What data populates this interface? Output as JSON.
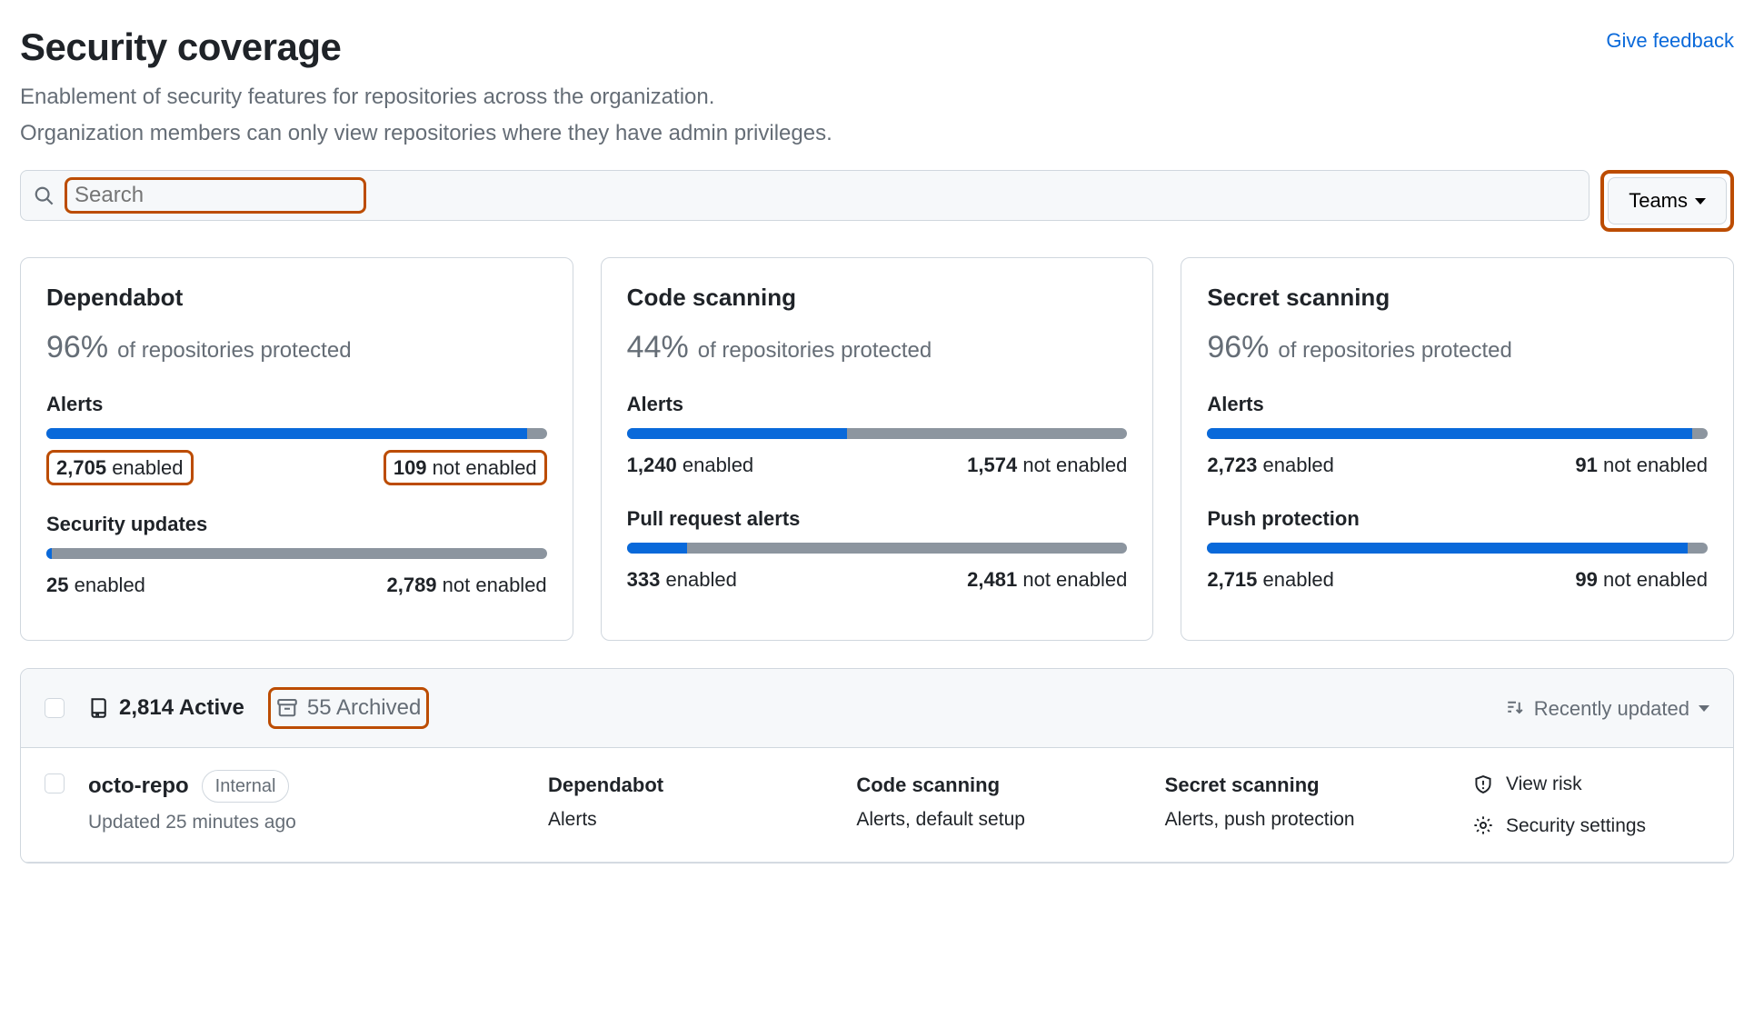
{
  "header": {
    "title": "Security coverage",
    "subtitle1": "Enablement of security features for repositories across the organization.",
    "subtitle2": "Organization members can only view repositories where they have admin privileges.",
    "feedback_label": "Give feedback"
  },
  "search": {
    "placeholder": "Search",
    "teams_label": "Teams"
  },
  "cards": [
    {
      "title": "Dependabot",
      "pct": "96%",
      "pct_suffix": "of repositories protected",
      "metrics": [
        {
          "label": "Alerts",
          "enabled_n": "2,705",
          "notenabled_n": "109",
          "fill": 96,
          "highlight_counts": true
        },
        {
          "label": "Security updates",
          "enabled_n": "25",
          "notenabled_n": "2,789",
          "fill": 1
        }
      ]
    },
    {
      "title": "Code scanning",
      "pct": "44%",
      "pct_suffix": "of repositories protected",
      "metrics": [
        {
          "label": "Alerts",
          "enabled_n": "1,240",
          "notenabled_n": "1,574",
          "fill": 44
        },
        {
          "label": "Pull request alerts",
          "enabled_n": "333",
          "notenabled_n": "2,481",
          "fill": 12
        }
      ]
    },
    {
      "title": "Secret scanning",
      "pct": "96%",
      "pct_suffix": "of repositories protected",
      "metrics": [
        {
          "label": "Alerts",
          "enabled_n": "2,723",
          "notenabled_n": "91",
          "fill": 97
        },
        {
          "label": "Push protection",
          "enabled_n": "2,715",
          "notenabled_n": "99",
          "fill": 96
        }
      ]
    }
  ],
  "labels": {
    "enabled": "enabled",
    "not_enabled": "not enabled"
  },
  "list": {
    "active_count": "2,814",
    "active_label": "Active",
    "archived_count": "55",
    "archived_label": "Archived",
    "sort_label": "Recently updated"
  },
  "repo": {
    "name": "octo-repo",
    "visibility": "Internal",
    "updated": "Updated 25 minutes ago",
    "cols": [
      {
        "title": "Dependabot",
        "sub": "Alerts"
      },
      {
        "title": "Code scanning",
        "sub": "Alerts, default setup"
      },
      {
        "title": "Secret scanning",
        "sub": "Alerts, push protection"
      }
    ],
    "actions": {
      "view_risk": "View risk",
      "security_settings": "Security settings"
    }
  }
}
